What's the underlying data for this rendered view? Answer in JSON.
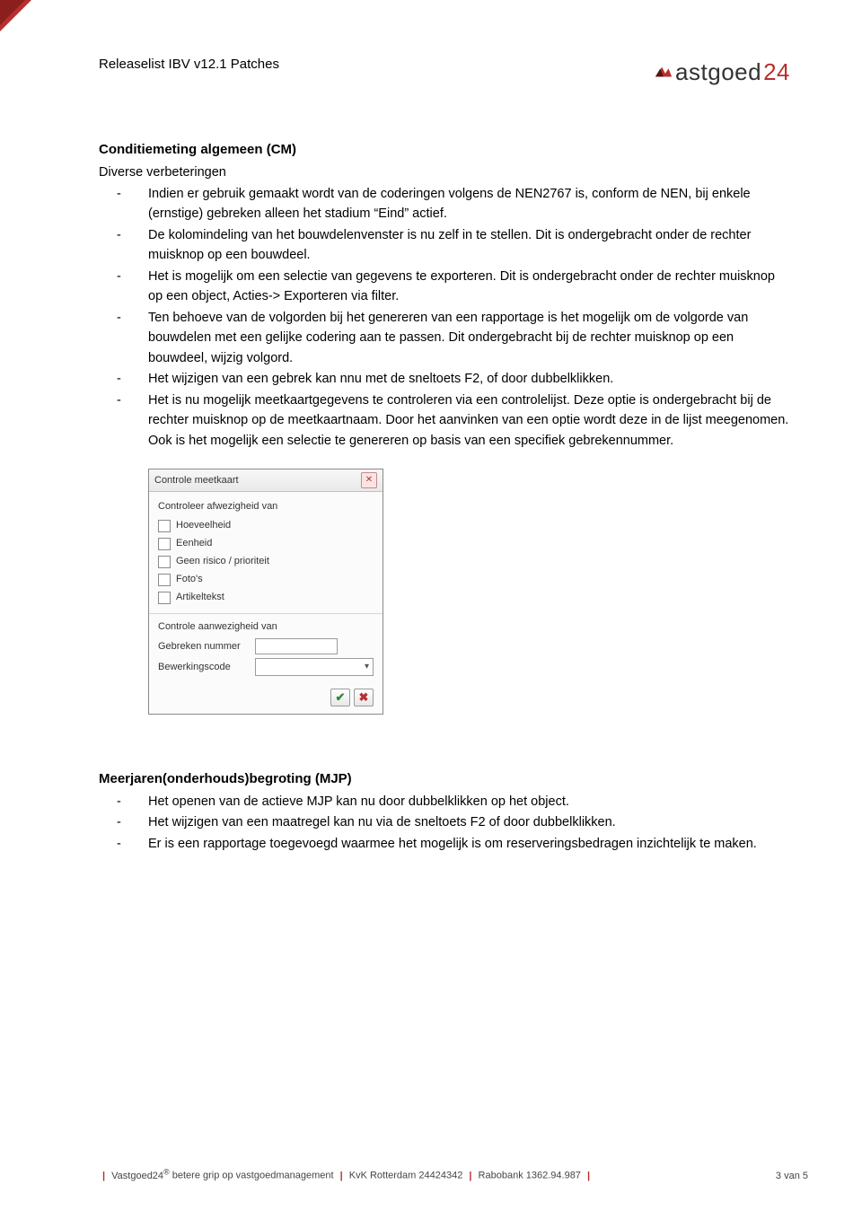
{
  "header": {
    "title": "Releaselist IBV v12.1 Patches",
    "brand_a": "astgoed",
    "brand_b": "24"
  },
  "section1": {
    "heading": "Conditiemeting algemeen (CM)",
    "subheading": "Diverse verbeteringen",
    "items": [
      "Indien er gebruik gemaakt wordt van de coderingen volgens de NEN2767 is, conform de NEN, bij enkele (ernstige) gebreken alleen het stadium “Eind” actief.",
      "De kolomindeling van het bouwdelenvenster is nu zelf in te stellen. Dit is ondergebracht onder de rechter muisknop op een bouwdeel.",
      "Het is mogelijk om een selectie van gegevens te exporteren. Dit is ondergebracht onder de rechter muisknop op een object, Acties-> Exporteren via filter.",
      "Ten behoeve van de volgorden bij het genereren van een rapportage is het mogelijk om de volgorde van bouwdelen met een gelijke codering aan te passen. Dit ondergebracht bij de rechter muisknop op een bouwdeel, wijzig volgord.",
      "Het wijzigen van een gebrek kan nnu met de sneltoets F2, of door dubbelklikken.",
      "Het is nu mogelijk meetkaartgegevens te controleren via een controlelijst. Deze optie is ondergebracht bij de rechter muisknop op de meetkaartnaam. Door het aanvinken van een optie wordt deze in de lijst meegenomen. Ook is het mogelijk een selectie te genereren op basis van een specifiek gebrekennummer."
    ]
  },
  "dialog": {
    "title": "Controle meetkaart",
    "group1_label": "Controleer afwezigheid van",
    "checks": [
      "Hoeveelheid",
      "Eenheid",
      "Geen risico / prioriteit",
      "Foto's",
      "Artikeltekst"
    ],
    "group2_label": "Controle aanwezigheid van",
    "field1": "Gebreken nummer",
    "field2": "Bewerkingscode"
  },
  "section2": {
    "heading": "Meerjaren(onderhouds)begroting (MJP)",
    "items": [
      "Het openen van de actieve MJP kan nu door dubbelklikken op het object.",
      "Het wijzigen van een maatregel kan nu via de sneltoets F2 of door dubbelklikken.",
      "Er is een rapportage toegevoegd waarmee het mogelijk is om reserveringsbedragen inzichtelijk te maken."
    ]
  },
  "footer": {
    "brand": "Vastgoed24",
    "tagline": "betere grip op vastgoedmanagement",
    "kvk": "KvK Rotterdam 24424342",
    "bank": "Rabobank 1362.94.987",
    "page": "3 van 5"
  }
}
